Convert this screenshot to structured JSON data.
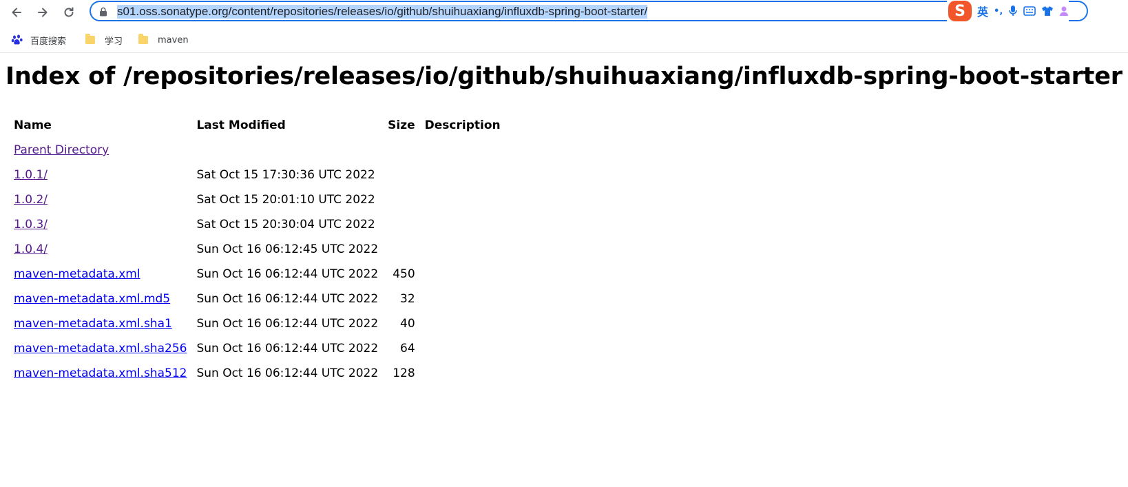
{
  "browser": {
    "url": "s01.oss.sonatype.org/content/repositories/releases/io/github/shuihuaxiang/influxdb-spring-boot-starter/",
    "ime": {
      "logo": "S",
      "mode": "英",
      "punct": "•,",
      "icons": [
        "microphone-icon",
        "keyboard-icon",
        "shirt-icon",
        "user-icon"
      ]
    },
    "bookmarks": [
      {
        "label": "百度搜索",
        "icon": "baidu-paw-icon"
      },
      {
        "label": "学习",
        "icon": "folder-icon"
      },
      {
        "label": "maven",
        "icon": "folder-icon"
      }
    ]
  },
  "page": {
    "title": "Index of /repositories/releases/io/github/shuihuaxiang/influxdb-spring-boot-starter",
    "columns": {
      "name": "Name",
      "modified": "Last Modified",
      "size": "Size",
      "description": "Description"
    },
    "parent": "Parent Directory",
    "rows": [
      {
        "name": "1.0.1/",
        "modified": "Sat Oct 15 17:30:36 UTC 2022",
        "size": "",
        "visited": true
      },
      {
        "name": "1.0.2/",
        "modified": "Sat Oct 15 20:01:10 UTC 2022",
        "size": "",
        "visited": true
      },
      {
        "name": "1.0.3/",
        "modified": "Sat Oct 15 20:30:04 UTC 2022",
        "size": "",
        "visited": true
      },
      {
        "name": "1.0.4/",
        "modified": "Sun Oct 16 06:12:45 UTC 2022",
        "size": "",
        "visited": true
      },
      {
        "name": "maven-metadata.xml",
        "modified": "Sun Oct 16 06:12:44 UTC 2022",
        "size": "450",
        "visited": false
      },
      {
        "name": "maven-metadata.xml.md5",
        "modified": "Sun Oct 16 06:12:44 UTC 2022",
        "size": "32",
        "visited": false
      },
      {
        "name": "maven-metadata.xml.sha1",
        "modified": "Sun Oct 16 06:12:44 UTC 2022",
        "size": "40",
        "visited": false
      },
      {
        "name": "maven-metadata.xml.sha256",
        "modified": "Sun Oct 16 06:12:44 UTC 2022",
        "size": "64",
        "visited": false
      },
      {
        "name": "maven-metadata.xml.sha512",
        "modified": "Sun Oct 16 06:12:44 UTC 2022",
        "size": "128",
        "visited": false
      }
    ]
  },
  "colors": {
    "link": "#0000ee",
    "visited": "#551a8b",
    "focus": "#1a73e8",
    "selection": "#b4d5fe"
  }
}
